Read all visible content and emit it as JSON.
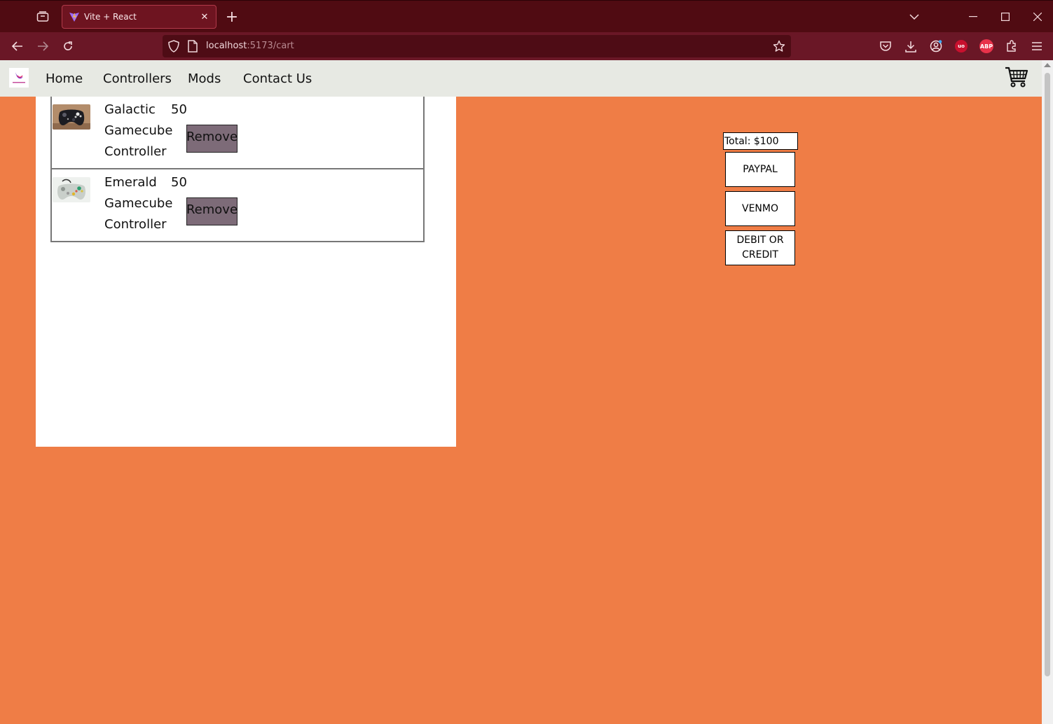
{
  "browser": {
    "tab_title": "Vite + React",
    "url_host": "localhost",
    "url_rest": ":5173/cart"
  },
  "site": {
    "nav": {
      "home": "Home",
      "controllers": "Controllers",
      "mods": "Mods",
      "contact": "Contact Us"
    }
  },
  "cart": {
    "items": [
      {
        "name": "Galactic Gamecube Controller",
        "price": "50",
        "remove_label": "Remove",
        "image_icon": "black-controller-photo"
      },
      {
        "name": "Emerald Gamecube Controller",
        "price": "50",
        "remove_label": "Remove",
        "image_icon": "grey-controller-photo"
      }
    ]
  },
  "checkout": {
    "total": "Total: $100",
    "paypal": "PAYPAL",
    "venmo": "VENMO",
    "card": "DEBIT OR CREDIT"
  },
  "colors": {
    "page_background": "#ef7d46",
    "header_background": "#e7e9e3",
    "remove_button": "#7d6b78",
    "browser_frame": "#500b12"
  }
}
